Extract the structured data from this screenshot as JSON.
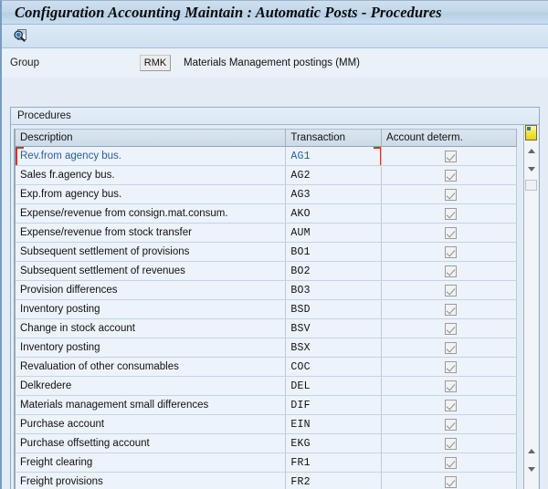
{
  "window": {
    "title": "Configuration Accounting Maintain : Automatic Posts - Procedures"
  },
  "toolbar": {
    "buttons": [
      {
        "name": "display-details-icon",
        "tooltip": "Display details",
        "glyph": "magnifier-document"
      }
    ]
  },
  "group_form": {
    "label": "Group",
    "key_value": "RMK",
    "description": "Materials Management postings (MM)"
  },
  "procedures_box": {
    "legend": "Procedures",
    "columns": [
      "Description",
      "Transaction",
      "Account determ."
    ],
    "rows": [
      {
        "description": "Rev.from agency bus.",
        "transaction": "AG1",
        "account_determ": true,
        "selected": true
      },
      {
        "description": "Sales fr.agency bus.",
        "transaction": "AG2",
        "account_determ": true,
        "selected": false
      },
      {
        "description": "Exp.from agency bus.",
        "transaction": "AG3",
        "account_determ": true,
        "selected": false
      },
      {
        "description": "Expense/revenue from consign.mat.consum.",
        "transaction": "AKO",
        "account_determ": true,
        "selected": false
      },
      {
        "description": "Expense/revenue from stock transfer",
        "transaction": "AUM",
        "account_determ": true,
        "selected": false
      },
      {
        "description": "Subsequent settlement of provisions",
        "transaction": "BO1",
        "account_determ": true,
        "selected": false
      },
      {
        "description": "Subsequent settlement of revenues",
        "transaction": "BO2",
        "account_determ": true,
        "selected": false
      },
      {
        "description": "Provision differences",
        "transaction": "BO3",
        "account_determ": true,
        "selected": false
      },
      {
        "description": "Inventory posting",
        "transaction": "BSD",
        "account_determ": true,
        "selected": false
      },
      {
        "description": "Change in stock account",
        "transaction": "BSV",
        "account_determ": true,
        "selected": false
      },
      {
        "description": "Inventory posting",
        "transaction": "BSX",
        "account_determ": true,
        "selected": false
      },
      {
        "description": "Revaluation of other consumables",
        "transaction": "COC",
        "account_determ": true,
        "selected": false
      },
      {
        "description": "Delkredere",
        "transaction": "DEL",
        "account_determ": true,
        "selected": false
      },
      {
        "description": "Materials management small differences",
        "transaction": "DIF",
        "account_determ": true,
        "selected": false
      },
      {
        "description": "Purchase account",
        "transaction": "EIN",
        "account_determ": true,
        "selected": false
      },
      {
        "description": "Purchase offsetting account",
        "transaction": "EKG",
        "account_determ": true,
        "selected": false
      },
      {
        "description": "Freight clearing",
        "transaction": "FR1",
        "account_determ": true,
        "selected": false
      },
      {
        "description": "Freight provisions",
        "transaction": "FR2",
        "account_determ": true,
        "selected": false
      }
    ]
  },
  "scrollbar": {
    "name": "vertical-scrollbar",
    "position": "top",
    "up_arrow": "scroll-up-icon",
    "down_arrow": "scroll-down-icon"
  },
  "colors": {
    "title_band": "#c2d7ea",
    "window_bg": "#e3ecf5",
    "row_bg": "#edf3fa",
    "selection_border": "#d0342c",
    "selected_text": "#2a5f9e",
    "scroll_thumb": "#f6e43d"
  }
}
